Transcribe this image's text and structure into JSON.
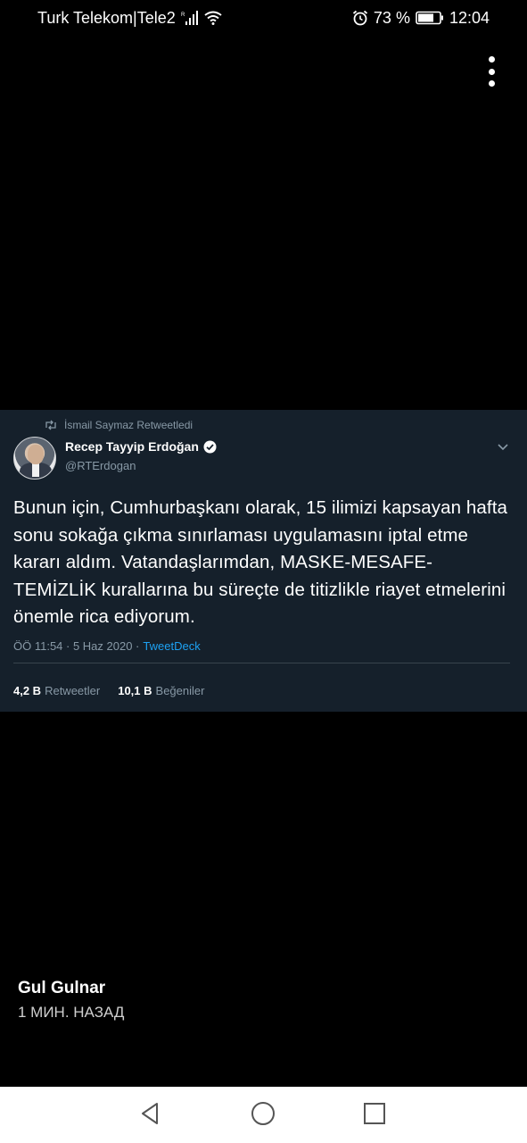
{
  "status_bar": {
    "carrier": "Turk Telekom|Tele2",
    "battery_percent": "73 %",
    "time": "12:04",
    "icons": [
      "signal-icon",
      "wifi-icon",
      "alarm-icon",
      "battery-icon"
    ]
  },
  "tweet": {
    "retweeted_by": "İsmail Saymaz Retweetledi",
    "author_name": "Recep Tayyip Erdoğan",
    "author_handle": "@RTErdogan",
    "text": "Bunun için, Cumhurbaşkanı olarak, 15 ilimizi kapsayan hafta sonu sokağa çıkma sınırlaması uygulamasını iptal etme kararı aldım. Vatandaşlarımdan, MASKE-MESAFE-TEMİZLİK kurallarına bu süreçte de titizlikle riayet etmelerini önemle rica ediyorum.",
    "timestamp": "ÖÖ 11:54 · 5 Haz 2020 ·",
    "source": "TweetDeck",
    "retweets_count": "4,2 B",
    "retweets_label": "Retweetler",
    "likes_count": "10,1 B",
    "likes_label": "Beğeniler",
    "colors": {
      "card_background": "#15202b",
      "muted_text": "#8899a6",
      "link": "#1da1f2",
      "divider": "#38444d"
    }
  },
  "post": {
    "author": "Gul Gulnar",
    "time_ago": "1 МИН. НАЗАД"
  },
  "nav_bar": {
    "icons": [
      "back-icon",
      "home-icon",
      "recent-apps-icon"
    ]
  }
}
